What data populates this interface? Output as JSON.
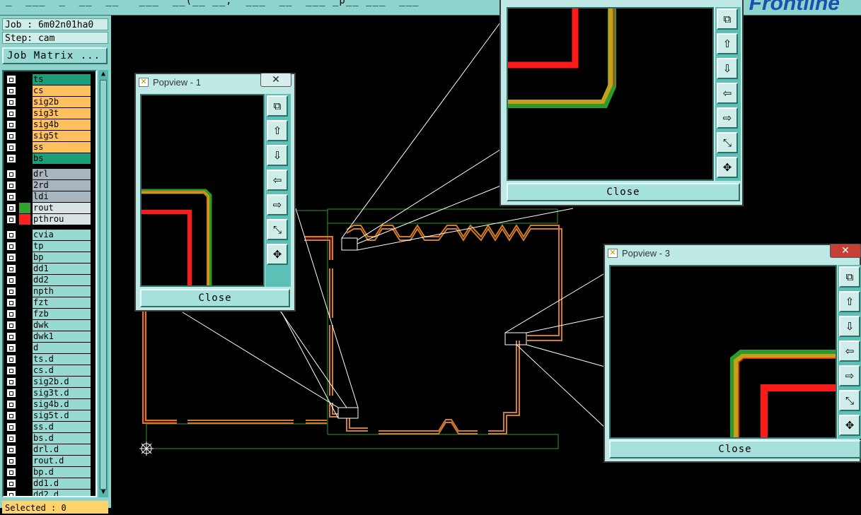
{
  "topbar": {
    "menu_text": "_  ___  _  __  __   ___  __(__ __,  ___  __  ___ _p__ ___  ___",
    "brand": "Frontline"
  },
  "job": {
    "job_label": "Job : 6m02n01ha0",
    "step_label": "Step: cam",
    "job_matrix_button": "Job Matrix ..."
  },
  "layers": [
    {
      "name": "ts",
      "color": "#1e9e78",
      "swatch": "#000"
    },
    {
      "name": "cs",
      "color": "#ffc060",
      "swatch": "#000"
    },
    {
      "name": "sig2b",
      "color": "#ffc060",
      "swatch": "#000"
    },
    {
      "name": "sig3t",
      "color": "#ffc060",
      "swatch": "#000"
    },
    {
      "name": "sig4b",
      "color": "#ffc060",
      "swatch": "#000"
    },
    {
      "name": "sig5t",
      "color": "#ffc060",
      "swatch": "#000"
    },
    {
      "name": "ss",
      "color": "#ffc060",
      "swatch": "#000"
    },
    {
      "name": "bs",
      "color": "#1e9e78",
      "swatch": "#000"
    },
    {
      "name": "drl",
      "color": "#a7b6be",
      "swatch": "#000"
    },
    {
      "name": "2rd",
      "color": "#a7b6be",
      "swatch": "#000"
    },
    {
      "name": "ldi",
      "color": "#a7b6be",
      "swatch": "#000"
    },
    {
      "name": "rout",
      "color": "#d9e3e6",
      "swatch": "#2fa52f"
    },
    {
      "name": "pthrou",
      "color": "#d9e3e6",
      "swatch": "#ff2020"
    },
    {
      "name": "cvia",
      "color": "#99d9d4",
      "swatch": "#000"
    },
    {
      "name": "tp",
      "color": "#99d9d4",
      "swatch": "#000"
    },
    {
      "name": "bp",
      "color": "#99d9d4",
      "swatch": "#000"
    },
    {
      "name": "dd1",
      "color": "#99d9d4",
      "swatch": "#000"
    },
    {
      "name": "dd2",
      "color": "#99d9d4",
      "swatch": "#000"
    },
    {
      "name": "npth",
      "color": "#99d9d4",
      "swatch": "#000"
    },
    {
      "name": "fzt",
      "color": "#99d9d4",
      "swatch": "#000"
    },
    {
      "name": "fzb",
      "color": "#99d9d4",
      "swatch": "#000"
    },
    {
      "name": "dwk",
      "color": "#99d9d4",
      "swatch": "#000"
    },
    {
      "name": "dwk1",
      "color": "#99d9d4",
      "swatch": "#000"
    },
    {
      "name": "d",
      "color": "#99d9d4",
      "swatch": "#000"
    },
    {
      "name": "ts.d",
      "color": "#99d9d4",
      "swatch": "#000"
    },
    {
      "name": "cs.d",
      "color": "#99d9d4",
      "swatch": "#000"
    },
    {
      "name": "sig2b.d",
      "color": "#99d9d4",
      "swatch": "#000"
    },
    {
      "name": "sig3t.d",
      "color": "#99d9d4",
      "swatch": "#000"
    },
    {
      "name": "sig4b.d",
      "color": "#99d9d4",
      "swatch": "#000"
    },
    {
      "name": "sig5t.d",
      "color": "#99d9d4",
      "swatch": "#000"
    },
    {
      "name": "ss.d",
      "color": "#99d9d4",
      "swatch": "#000"
    },
    {
      "name": "bs.d",
      "color": "#99d9d4",
      "swatch": "#000"
    },
    {
      "name": "drl.d",
      "color": "#99d9d4",
      "swatch": "#000"
    },
    {
      "name": "rout.d",
      "color": "#99d9d4",
      "swatch": "#000"
    },
    {
      "name": "bp.d",
      "color": "#99d9d4",
      "swatch": "#000"
    },
    {
      "name": "dd1.d",
      "color": "#99d9d4",
      "swatch": "#000"
    },
    {
      "name": "dd2.d",
      "color": "#99d9d4",
      "swatch": "#000"
    }
  ],
  "status": {
    "selected": "Selected : 0"
  },
  "popups": {
    "p1": {
      "title": "Popview - 1",
      "close_label": "Close",
      "x_glyph": "✕"
    },
    "p2": {
      "title": "",
      "close_label": "Close"
    },
    "p3": {
      "title": "Popview - 3",
      "close_label": "Close",
      "x_glyph": "✕"
    }
  },
  "colors": {
    "ui_teal": "#99d9d4",
    "board_outline": "#2d9a2d",
    "trace_orange": "#d27b2c",
    "trace_red": "#ff1a1a",
    "trace_olive": "#b4a51e"
  }
}
